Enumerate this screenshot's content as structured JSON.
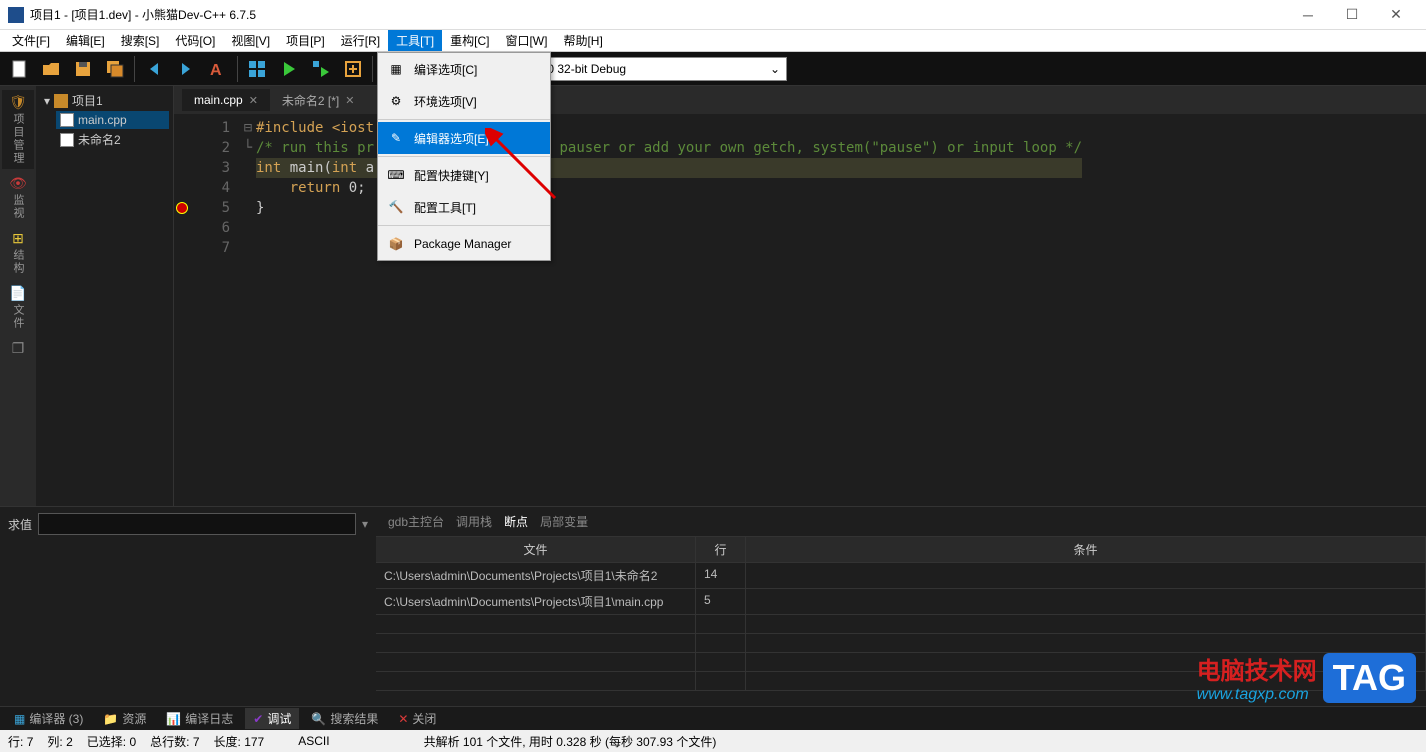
{
  "title": "项目1 - [项目1.dev] - 小熊猫Dev-C++ 6.7.5",
  "menubar": [
    "文件[F]",
    "编辑[E]",
    "搜索[S]",
    "代码[O]",
    "视图[V]",
    "项目[P]",
    "运行[R]",
    "工具[T]",
    "重构[C]",
    "窗口[W]",
    "帮助[H]"
  ],
  "menubar_active": 7,
  "compiler": "MinGW GCC 9.2.0 32-bit Debug",
  "left_rail": [
    "项目管理",
    "监视",
    "结构",
    "文件"
  ],
  "project": {
    "root": "项目1",
    "files": [
      "main.cpp",
      "未命名2"
    ],
    "selected": 0
  },
  "tabs": [
    {
      "label": "main.cpp",
      "active": true,
      "dirty": false
    },
    {
      "label": "未命名2 [*]",
      "active": false,
      "dirty": true
    }
  ],
  "code": {
    "lines": [
      {
        "n": "1",
        "html": "<span class='pp'>#include</span> <span class='str'>&lt;iost</span>"
      },
      {
        "n": "2",
        "html": ""
      },
      {
        "n": "3",
        "html": "<span class='cm'>/* run this pr</span>                 <span class='cm'>sole pauser or add your own getch, system(\"pause\") or input loop */</span>"
      },
      {
        "n": "4",
        "html": ""
      },
      {
        "n": "5",
        "html": "<span class='kw'>int</span> main(<span class='kw'>int</span> a",
        "bp": true,
        "fold": "⊟"
      },
      {
        "n": "6",
        "html": "    <span class='kw'>return</span> 0;"
      },
      {
        "n": "7",
        "html": "}",
        "fold": "└"
      }
    ]
  },
  "tools_menu": [
    {
      "label": "编译选项[C]",
      "icon": "grid"
    },
    {
      "label": "环境选项[V]",
      "icon": "gears"
    },
    {
      "sep": true
    },
    {
      "label": "编辑器选项[E]",
      "icon": "pencil",
      "highlight": true
    },
    {
      "sep": true
    },
    {
      "label": "配置快捷键[Y]",
      "icon": "keys"
    },
    {
      "label": "配置工具[T]",
      "icon": "hammer"
    },
    {
      "sep": true
    },
    {
      "label": "Package Manager",
      "icon": "box"
    }
  ],
  "search_label": "求值",
  "debug_tabs": [
    "gdb主控台",
    "调用栈",
    "断点",
    "局部变量"
  ],
  "debug_tab_active": 2,
  "bp_table": {
    "headers": [
      "文件",
      "行",
      "条件"
    ],
    "rows": [
      {
        "file": "C:\\Users\\admin\\Documents\\Projects\\项目1\\未命名2",
        "line": "14",
        "cond": ""
      },
      {
        "file": "C:\\Users\\admin\\Documents\\Projects\\项目1\\main.cpp",
        "line": "5",
        "cond": ""
      }
    ]
  },
  "bottom_tabs": [
    {
      "label": "编译器 (3)",
      "icon": "tiles"
    },
    {
      "label": "资源",
      "icon": "res"
    },
    {
      "label": "编译日志",
      "icon": "bars"
    },
    {
      "label": "调试",
      "icon": "check",
      "active": true
    },
    {
      "label": "搜索结果",
      "icon": "search"
    },
    {
      "label": "关闭",
      "icon": "close"
    }
  ],
  "status": {
    "line": "行:",
    "line_v": "7",
    "col": "列:",
    "col_v": "2",
    "sel": "已选择:",
    "sel_v": "0",
    "total": "总行数:",
    "total_v": "7",
    "len": "长度:",
    "len_v": "177",
    "enc": "ASCII",
    "parse": "共解析 101 个文件, 用时 0.328 秒 (每秒 307.93 个文件)"
  },
  "watermark": {
    "text": "电脑技术网",
    "tag": "TAG",
    "url": "www.tagxp.com"
  }
}
